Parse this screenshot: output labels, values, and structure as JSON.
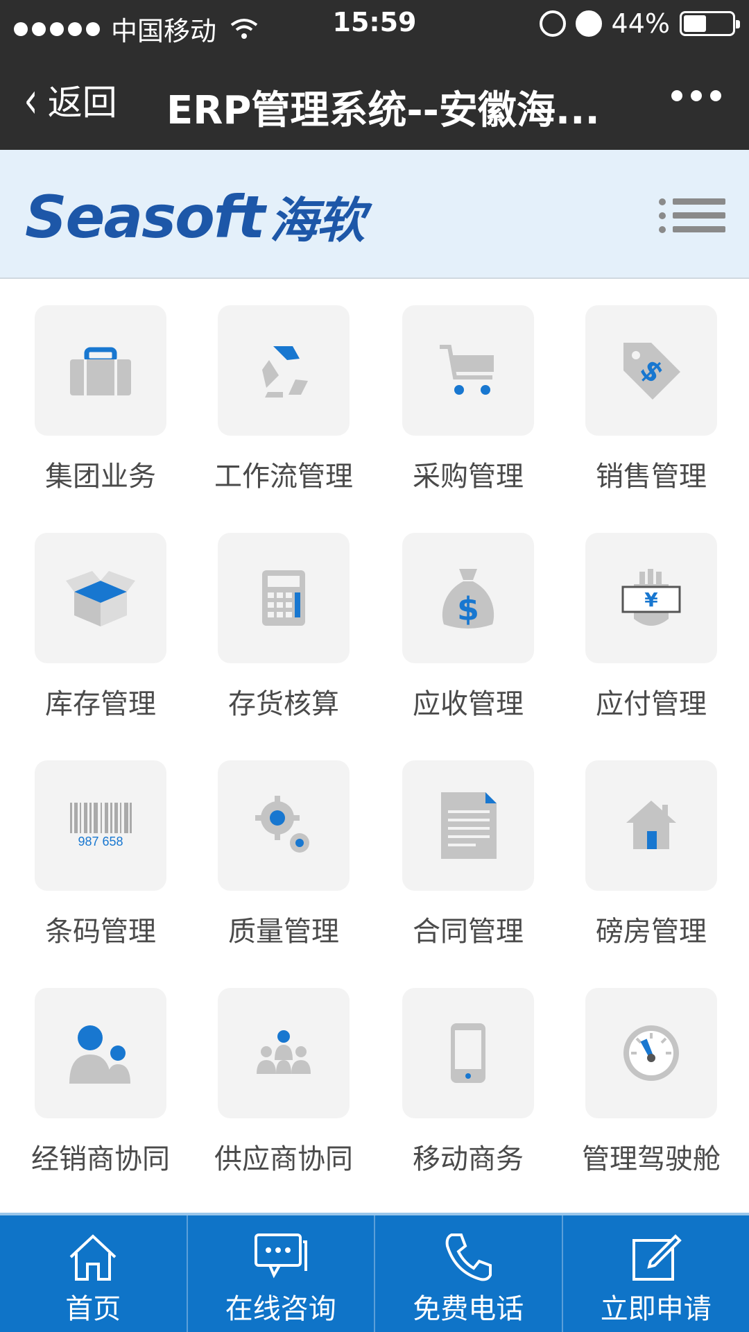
{
  "status": {
    "carrier": "中国移动",
    "time": "15:59",
    "battery": "44%"
  },
  "nav": {
    "back_label": "返回",
    "title": "ERP管理系统--安徽海..."
  },
  "brand": {
    "logo_en": "Seasoft",
    "logo_cn": "海软"
  },
  "modules": [
    {
      "label": "集团业务",
      "icon": "briefcase-icon"
    },
    {
      "label": "工作流管理",
      "icon": "recycle-icon"
    },
    {
      "label": "采购管理",
      "icon": "cart-icon"
    },
    {
      "label": "销售管理",
      "icon": "price-tag-icon"
    },
    {
      "label": "库存管理",
      "icon": "box-icon"
    },
    {
      "label": "存货核算",
      "icon": "calculator-icon"
    },
    {
      "label": "应收管理",
      "icon": "money-bag-icon"
    },
    {
      "label": "应付管理",
      "icon": "yen-hand-icon"
    },
    {
      "label": "条码管理",
      "icon": "barcode-icon",
      "barcode_text": "987 658"
    },
    {
      "label": "质量管理",
      "icon": "gears-icon"
    },
    {
      "label": "合同管理",
      "icon": "document-icon"
    },
    {
      "label": "磅房管理",
      "icon": "house-icon"
    },
    {
      "label": "经销商协同",
      "icon": "dealers-icon"
    },
    {
      "label": "供应商协同",
      "icon": "suppliers-icon"
    },
    {
      "label": "移动商务",
      "icon": "mobile-icon"
    },
    {
      "label": "管理驾驶舱",
      "icon": "dashboard-icon"
    }
  ],
  "tabbar": [
    {
      "label": "首页",
      "icon": "home-icon"
    },
    {
      "label": "在线咨询",
      "icon": "chat-icon"
    },
    {
      "label": "免费电话",
      "icon": "phone-icon"
    },
    {
      "label": "立即申请",
      "icon": "edit-icon"
    }
  ],
  "colors": {
    "accent": "#0f74c8",
    "icon_blue": "#1877d0",
    "icon_gray": "#c4c4c4",
    "logo": "#1d57a8"
  }
}
